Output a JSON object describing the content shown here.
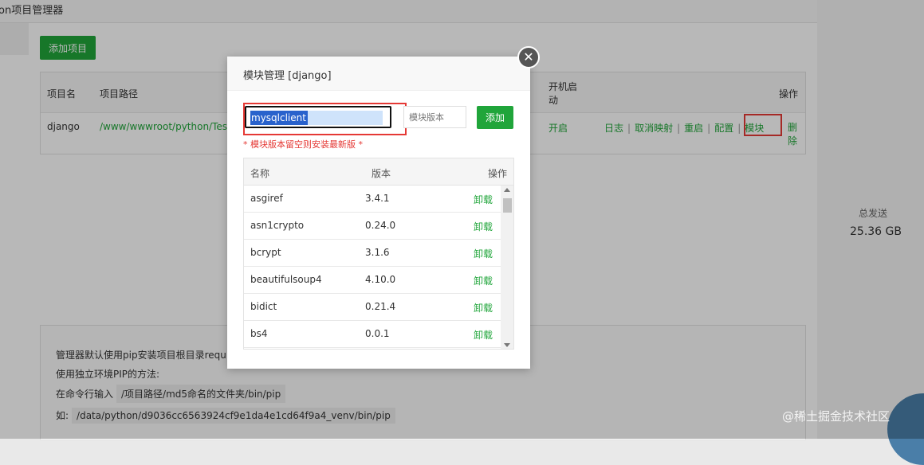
{
  "app": {
    "title": "on项目管理器"
  },
  "toolbar": {
    "add_project": "添加项目"
  },
  "project_table": {
    "headers": {
      "name": "项目名",
      "path": "项目路径",
      "autostart": "开机启动",
      "actions": "操作"
    },
    "row": {
      "name": "django",
      "path": "/www/wwwroot/python/Tes",
      "autostart": "开启",
      "actions": [
        "日志",
        "取消映射",
        "重启",
        "配置",
        "模块"
      ],
      "delete": "删除"
    }
  },
  "side_stats": {
    "label": "总发送",
    "value": "25.36 GB"
  },
  "info": {
    "line1": "管理器默认使用pip安装项目根目录requi",
    "line2": "使用独立环境PIP的方法:",
    "line3_label": "在命令行输入",
    "line3_code": "/项目路径/md5命名的文件夹/bin/pip",
    "line4_label": "如:",
    "line4_code": "/data/python/d9036cc6563924cf9e1da4e1cd64f9a4_venv/bin/pip"
  },
  "modal": {
    "title": "模块管理 [django]",
    "name_value": "mysqlclient",
    "version_placeholder": "模块版本",
    "add_label": "添加",
    "hint": "* 模块版本留空则安装最新版 *",
    "table_headers": {
      "name": "名称",
      "version": "版本",
      "action": "操作"
    },
    "modules": [
      {
        "name": "asgiref",
        "version": "3.4.1",
        "action": "卸载"
      },
      {
        "name": "asn1crypto",
        "version": "0.24.0",
        "action": "卸载"
      },
      {
        "name": "bcrypt",
        "version": "3.1.6",
        "action": "卸载"
      },
      {
        "name": "beautifulsoup4",
        "version": "4.10.0",
        "action": "卸载"
      },
      {
        "name": "bidict",
        "version": "0.21.4",
        "action": "卸载"
      },
      {
        "name": "bs4",
        "version": "0.0.1",
        "action": "卸载"
      },
      {
        "name": "",
        "version": "",
        "action": ""
      }
    ]
  },
  "watermark": "@稀土掘金技术社区",
  "colors": {
    "accent_green": "#20a53a",
    "highlight_red": "#e53935",
    "selection_blue": "#2962cc"
  }
}
